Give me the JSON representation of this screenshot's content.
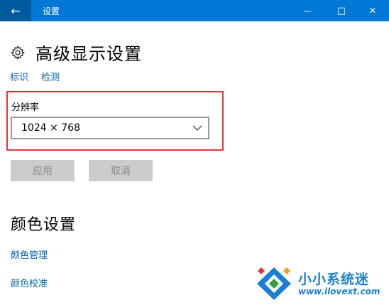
{
  "window": {
    "title": "设置",
    "back_icon": "←",
    "minimize_icon": "—",
    "maximize_icon": "□",
    "close_icon": "✕"
  },
  "page": {
    "title": "高级显示设置",
    "links": [
      "标识",
      "检测"
    ]
  },
  "resolution": {
    "label": "分辨率",
    "value": "1024 × 768"
  },
  "buttons": {
    "apply": "应用",
    "cancel": "取消"
  },
  "color_settings": {
    "title": "颜色设置",
    "links": [
      "颜色管理",
      "颜色校准"
    ]
  },
  "watermark": {
    "name": "小小系统迷",
    "url": "www.ilovext.com"
  },
  "colors": {
    "accent": "#0078d7",
    "link": "#0063b1",
    "highlight": "#e0363a"
  }
}
